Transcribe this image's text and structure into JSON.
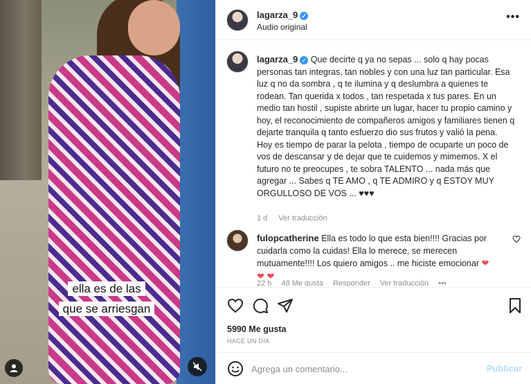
{
  "media": {
    "caption_line1": "ella es de las",
    "caption_line2": "que se arriesgan"
  },
  "header": {
    "username": "lagarza_9",
    "subtitle": "Audio original",
    "more_label": "•••"
  },
  "post": {
    "username": "lagarza_9",
    "text": "Que decirte q ya no sepas ... solo q hay pocas personas tan integras, tan nobles y con una luz tan particular. Esa luz q no da sombra , q te ilumina y q deslumbra a quienes te rodean. Tan querida x todos , tan respetada x tus pares. En un medio tan hostil , supiste abrirte un lugar, hacer tu propio camino y hoy, el reconocimiento de compañeros amigos y familiares tienen q dejarte tranquila q tanto esfuerzo dio sus frutos y valió la pena.",
    "text2": "Hoy es tiempo de parar la pelota , tiempo de ocuparte un poco de vos de descansar y de dejar que te cuidemos y mimemos. X el futuro no te preocupes , te sobra TALENTO ... nada más que agregar ... Sabes q TE AMO , q TE ADMIRO y q ESTOY MUY ORGULLOSO DE VOS ... ♥♥♥",
    "age": "1 d",
    "translate": "Ver traducción"
  },
  "comment": {
    "username": "fulopcatherine",
    "text": "Ella es todo lo que esta bien!!!! Gracias por cuidarla como la cuidas! Ella lo merece, se merecen mutuamente!!!! Los quiero amigos .. me hiciste emocionar",
    "hearts_inline": "❤",
    "hearts_line": "❤ ❤",
    "age": "22 h",
    "likes": "48 Me gusta",
    "reply": "Responder",
    "translate": "Ver traducción",
    "more": "•••"
  },
  "stats": {
    "likes": "5990 Me gusta",
    "time": "HACE UN DÍA"
  },
  "composer": {
    "placeholder": "Agrega un comentario...",
    "publish": "Publicar"
  },
  "colors": {
    "verified": "#3897f0",
    "heart": "#ed4956",
    "publish_disabled": "#b2dffc"
  }
}
